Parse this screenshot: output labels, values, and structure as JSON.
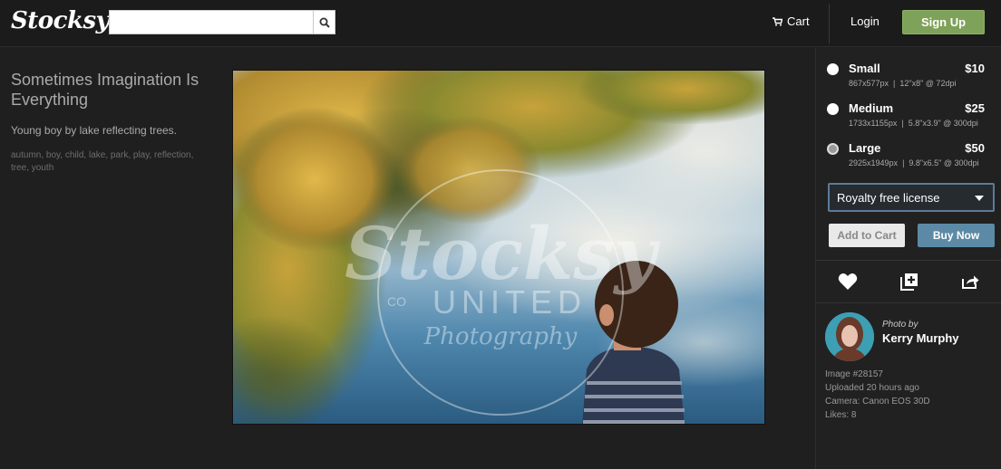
{
  "header": {
    "logo": "Stocksy",
    "search": {
      "value": "",
      "placeholder": ""
    },
    "cart_label": "Cart",
    "login_label": "Login",
    "signup_label": "Sign Up"
  },
  "image": {
    "title": "Sometimes Imagination Is Everything",
    "description": "Young boy by lake reflecting trees.",
    "tags": "autumn, boy, child, lake, park, play, reflection, tree, youth",
    "watermark": {
      "brand": "Stocksy",
      "co": "CO",
      "united": "UNITED",
      "photography": "Photography"
    }
  },
  "purchase": {
    "sizes": [
      {
        "name": "Small",
        "price": "$10",
        "px": "867x577px",
        "print": "12\"x8\" @ 72dpi",
        "selected": false
      },
      {
        "name": "Medium",
        "price": "$25",
        "px": "1733x1155px",
        "print": "5.8\"x3.9\" @ 300dpi",
        "selected": false
      },
      {
        "name": "Large",
        "price": "$50",
        "px": "2925x1949px",
        "print": "9.8\"x6.5\" @ 300dpi",
        "selected": true
      }
    ],
    "license": "Royalty free license",
    "add_to_cart_label": "Add to Cart",
    "buy_now_label": "Buy Now"
  },
  "actions": [
    "heart-icon",
    "add-to-collection-icon",
    "share-icon"
  ],
  "photographer": {
    "photo_by_label": "Photo by",
    "name": "Kerry Murphy",
    "image_id": "Image #28157",
    "uploaded": "Uploaded 20 hours ago",
    "camera": "Camera: Canon EOS 30D",
    "likes": "Likes: 8"
  }
}
